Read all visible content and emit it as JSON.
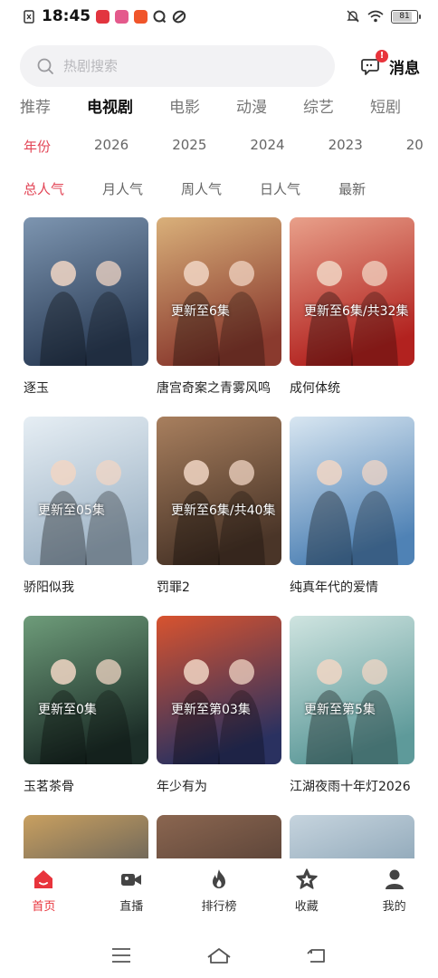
{
  "status_bar": {
    "time": "18:45",
    "battery": "81",
    "battery_level": 0.81,
    "app_icons": [
      "sim-icon",
      "app-icon-red",
      "app-icon-pink",
      "app-icon-orange",
      "q-app-icon",
      "link-app-icon"
    ]
  },
  "search": {
    "placeholder": "热剧搜索"
  },
  "messages": {
    "label": "消息",
    "badge": "!"
  },
  "category_tabs": [
    {
      "label": "推荐",
      "active": false
    },
    {
      "label": "电视剧",
      "active": true
    },
    {
      "label": "电影",
      "active": false
    },
    {
      "label": "动漫",
      "active": false
    },
    {
      "label": "综艺",
      "active": false
    },
    {
      "label": "短剧",
      "active": false
    }
  ],
  "years": [
    {
      "label": "年份",
      "active": true
    },
    {
      "label": "2026",
      "active": false
    },
    {
      "label": "2025",
      "active": false
    },
    {
      "label": "2024",
      "active": false
    },
    {
      "label": "2023",
      "active": false
    },
    {
      "label": "20",
      "active": false
    }
  ],
  "sort": [
    {
      "label": "总人气",
      "active": true
    },
    {
      "label": "月人气",
      "active": false
    },
    {
      "label": "周人气",
      "active": false
    },
    {
      "label": "日人气",
      "active": false
    },
    {
      "label": "最新",
      "active": false
    }
  ],
  "shows": [
    {
      "title": "逐玉",
      "update": "",
      "colors": [
        "#2c3e58",
        "#7d95b0"
      ]
    },
    {
      "title": "唐宫奇案之青雾风鸣",
      "update": "更新至6集",
      "colors": [
        "#8a3a2e",
        "#d9b07a"
      ]
    },
    {
      "title": "成何体统",
      "update": "更新至6集/共32集",
      "colors": [
        "#b2221f",
        "#e8a08a"
      ]
    },
    {
      "title": "骄阳似我",
      "update": "更新至05集",
      "colors": [
        "#9fb4c6",
        "#e6eef4"
      ]
    },
    {
      "title": "罚罪2",
      "update": "更新至6集/共40集",
      "colors": [
        "#4a3528",
        "#a87f5e"
      ]
    },
    {
      "title": "纯真年代的爱情",
      "update": "",
      "colors": [
        "#4f82b5",
        "#d8e6f1"
      ]
    },
    {
      "title": "玉茗茶骨",
      "update": "更新至0集",
      "colors": [
        "#1c2e28",
        "#6e9c7a"
      ]
    },
    {
      "title": "年少有为",
      "update": "更新至第03集",
      "colors": [
        "#2a3160",
        "#d8532f"
      ]
    },
    {
      "title": "江湖夜雨十年灯2026",
      "update": "更新至第5集",
      "colors": [
        "#5e9a9a",
        "#cfe4e0"
      ]
    },
    {
      "title": "",
      "update": "",
      "colors": [
        "#2b3c55",
        "#c9a060"
      ]
    },
    {
      "title": "",
      "update": "",
      "colors": [
        "#3a2c28",
        "#8b6650"
      ]
    },
    {
      "title": "",
      "update": "",
      "colors": [
        "#6b8aa0",
        "#c6d4de"
      ]
    }
  ],
  "bottom_nav": [
    {
      "label": "首页",
      "icon": "home-icon",
      "active": true
    },
    {
      "label": "直播",
      "icon": "video-camera-icon",
      "active": false
    },
    {
      "label": "排行榜",
      "icon": "flame-icon",
      "active": false
    },
    {
      "label": "收藏",
      "icon": "star-icon",
      "active": false
    },
    {
      "label": "我的",
      "icon": "profile-icon",
      "active": false
    }
  ],
  "colors": {
    "accent": "#e24455",
    "nav_active": "#e8343c"
  }
}
